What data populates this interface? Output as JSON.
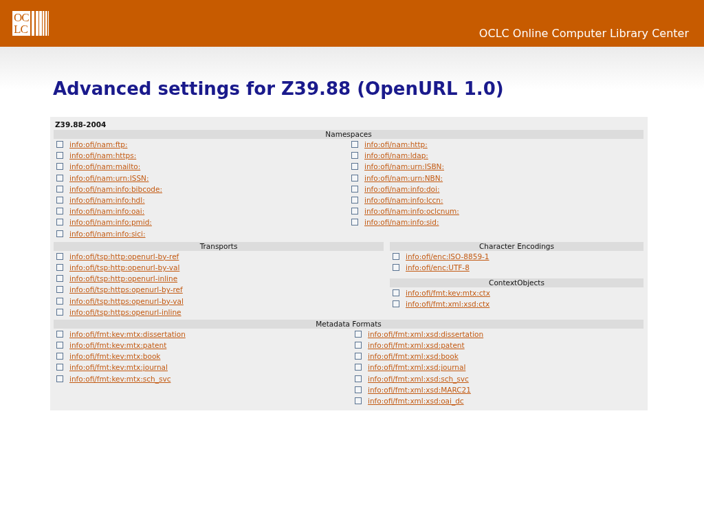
{
  "header": {
    "logo_lines": [
      "OC",
      "LC"
    ],
    "organization": "OCLC Online Computer Library Center"
  },
  "title": "Advanced settings for Z39.88 (OpenURL 1.0)",
  "panel": {
    "version": "Z39.88-2004",
    "namespaces": {
      "heading": "Namespaces",
      "columns": [
        [
          {
            "label": "info:ofi/nam:ftp:",
            "checked": false
          },
          {
            "label": "info:ofi/nam:https:",
            "checked": false
          },
          {
            "label": "info:ofi/nam:mailto:",
            "checked": false
          },
          {
            "label": "info:ofi/nam:urn:ISSN:",
            "checked": false
          },
          {
            "label": "info:ofi/nam:info:bibcode:",
            "checked": false
          },
          {
            "label": "info:ofi/nam:info:hdl:",
            "checked": false
          },
          {
            "label": "info:ofi/nam:info:oai:",
            "checked": false
          },
          {
            "label": "info:ofi/nam:info:pmid:",
            "checked": false
          },
          {
            "label": "info:ofi/nam:info:sici:",
            "checked": false
          }
        ],
        [
          {
            "label": "info:ofi/nam:http:",
            "checked": false
          },
          {
            "label": "info:ofi/nam:ldap:",
            "checked": false
          },
          {
            "label": "info:ofi/nam:urn:ISBN:",
            "checked": false
          },
          {
            "label": "info:ofi/nam:urn:NBN:",
            "checked": false
          },
          {
            "label": "info:ofi/nam:info:doi:",
            "checked": false
          },
          {
            "label": "info:ofi/nam:info:lccn:",
            "checked": false
          },
          {
            "label": "info:ofi/nam:info:oclcnum:",
            "checked": false
          },
          {
            "label": "info:ofi/nam:info:sid:",
            "checked": false
          }
        ]
      ]
    },
    "transports": {
      "heading": "Transports",
      "columns": [
        [
          {
            "label": "info:ofi/tsp:http:openurl-by-ref",
            "checked": false
          },
          {
            "label": "info:ofi/tsp:http:openurl-by-val",
            "checked": false
          },
          {
            "label": "info:ofi/tsp:http:openurl-inline",
            "checked": false
          },
          {
            "label": "info:ofi/tsp:https:openurl-by-ref",
            "checked": false
          },
          {
            "label": "info:ofi/tsp:https:openurl-by-val",
            "checked": false
          },
          {
            "label": "info:ofi/tsp:https:openurl-inline",
            "checked": false
          }
        ]
      ]
    },
    "character_encodings": {
      "heading": "Character Encodings",
      "columns": [
        [
          {
            "label": "info:ofi/enc:ISO-8859-1",
            "checked": false
          },
          {
            "label": "info:ofi/enc:UTF-8",
            "checked": false
          }
        ]
      ]
    },
    "context_objects": {
      "heading": "ContextObjects",
      "columns": [
        [
          {
            "label": "info:ofi/fmt:kev:mtx:ctx",
            "checked": false
          },
          {
            "label": "info:ofi/fmt:xml:xsd:ctx",
            "checked": false
          }
        ]
      ]
    },
    "metadata_formats": {
      "heading": "Metadata Formats",
      "columns": [
        [
          {
            "label": "info:ofi/fmt:kev:mtx:dissertation",
            "checked": false
          },
          {
            "label": "info:ofi/fmt:kev:mtx:patent",
            "checked": false
          },
          {
            "label": "info:ofi/fmt:kev:mtx:book",
            "checked": false
          },
          {
            "label": "info:ofi/fmt:kev:mtx:journal",
            "checked": false
          },
          {
            "label": "info:ofi/fmt:kev:mtx:sch_svc",
            "checked": false
          }
        ],
        [
          {
            "label": "info:ofi/fmt:xml:xsd:dissertation",
            "checked": false
          },
          {
            "label": "info:ofi/fmt:xml:xsd:patent",
            "checked": false
          },
          {
            "label": "info:ofi/fmt:xml:xsd:book",
            "checked": false
          },
          {
            "label": "info:ofi/fmt:xml:xsd:journal",
            "checked": false
          },
          {
            "label": "info:ofi/fmt:xml:xsd:sch_svc",
            "checked": false
          },
          {
            "label": "info:ofi/fmt:xml:xsd:MARC21",
            "checked": false
          },
          {
            "label": "info:ofi/fmt:xml:xsd:oai_dc",
            "checked": false
          }
        ]
      ]
    }
  }
}
